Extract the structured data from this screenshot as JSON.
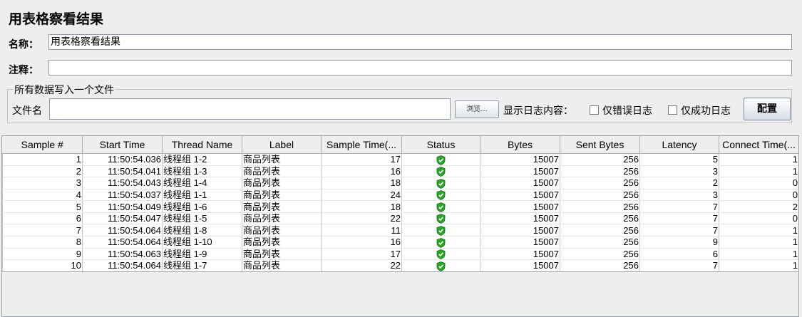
{
  "title": "用表格察看结果",
  "name_field": {
    "label": "名称：",
    "value": "用表格察看结果"
  },
  "comment_field": {
    "label": "注释：",
    "value": ""
  },
  "file_section": {
    "legend": "所有数据写入一个文件",
    "file_label": "文件名",
    "file_value": "",
    "browse_label": "浏览...",
    "log_label": "显示日志内容：",
    "errors_only_label": "仅错误日志",
    "success_only_label": "仅成功日志",
    "config_label": "配置"
  },
  "table": {
    "columns": [
      "Sample #",
      "Start Time",
      "Thread Name",
      "Label",
      "Sample Time(...",
      "Status",
      "Bytes",
      "Sent Bytes",
      "Latency",
      "Connect Time(..."
    ],
    "rows": [
      [
        "1",
        "11:50:54.036",
        "线程组 1-2",
        "商品列表",
        "17",
        "success",
        "15007",
        "256",
        "5",
        "1"
      ],
      [
        "2",
        "11:50:54.041",
        "线程组 1-3",
        "商品列表",
        "16",
        "success",
        "15007",
        "256",
        "3",
        "1"
      ],
      [
        "3",
        "11:50:54.043",
        "线程组 1-4",
        "商品列表",
        "18",
        "success",
        "15007",
        "256",
        "2",
        "0"
      ],
      [
        "4",
        "11:50:54.037",
        "线程组 1-1",
        "商品列表",
        "24",
        "success",
        "15007",
        "256",
        "3",
        "0"
      ],
      [
        "5",
        "11:50:54.049",
        "线程组 1-6",
        "商品列表",
        "18",
        "success",
        "15007",
        "256",
        "7",
        "2"
      ],
      [
        "6",
        "11:50:54.047",
        "线程组 1-5",
        "商品列表",
        "22",
        "success",
        "15007",
        "256",
        "7",
        "0"
      ],
      [
        "7",
        "11:50:54.064",
        "线程组 1-8",
        "商品列表",
        "11",
        "success",
        "15007",
        "256",
        "7",
        "1"
      ],
      [
        "8",
        "11:50:54.064",
        "线程组 1-10",
        "商品列表",
        "16",
        "success",
        "15007",
        "256",
        "9",
        "1"
      ],
      [
        "9",
        "11:50:54.063",
        "线程组 1-9",
        "商品列表",
        "17",
        "success",
        "15007",
        "256",
        "6",
        "1"
      ],
      [
        "10",
        "11:50:54.064",
        "线程组 1-7",
        "商品列表",
        "22",
        "success",
        "15007",
        "256",
        "7",
        "1"
      ]
    ]
  },
  "icons": {
    "status_success": "shield-check-icon"
  },
  "colors": {
    "success": "#2aa52a"
  }
}
